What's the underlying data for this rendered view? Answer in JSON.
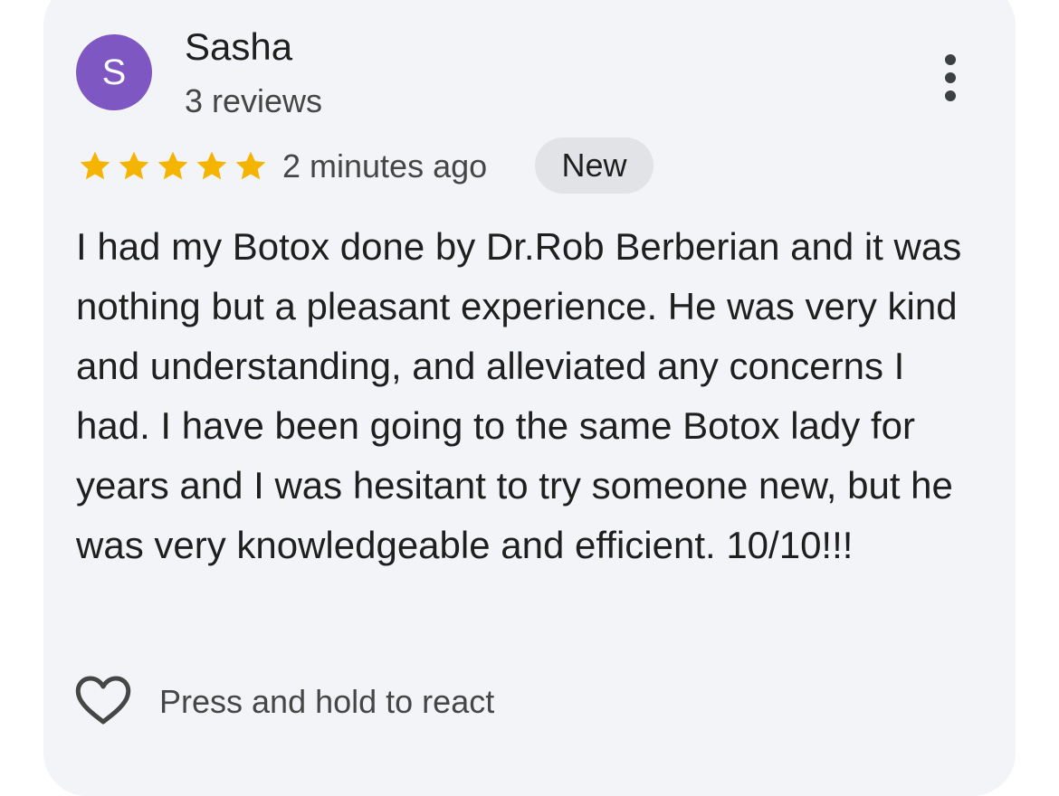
{
  "review": {
    "author": {
      "initial": "S",
      "name": "Sasha",
      "reviews_count": "3 reviews",
      "avatar_color": "#7e57c2"
    },
    "rating": 5,
    "rating_max": 5,
    "star_color": "#f4b400",
    "time_ago": "2 minutes ago",
    "badge": "New",
    "text": "I had my Botox done by Dr.Rob Berberian and it was nothing but a pleasant experience. He was very kind and understanding, and alleviated any concerns I had. I have been going to the same Botox lady for years and I was hesitant to try someone new, but he was very knowledgeable and efficient. 10/10!!!",
    "react_hint": "Press and hold to react",
    "icons": {
      "menu": "more-vert-icon",
      "react": "heart-outline-icon"
    }
  }
}
